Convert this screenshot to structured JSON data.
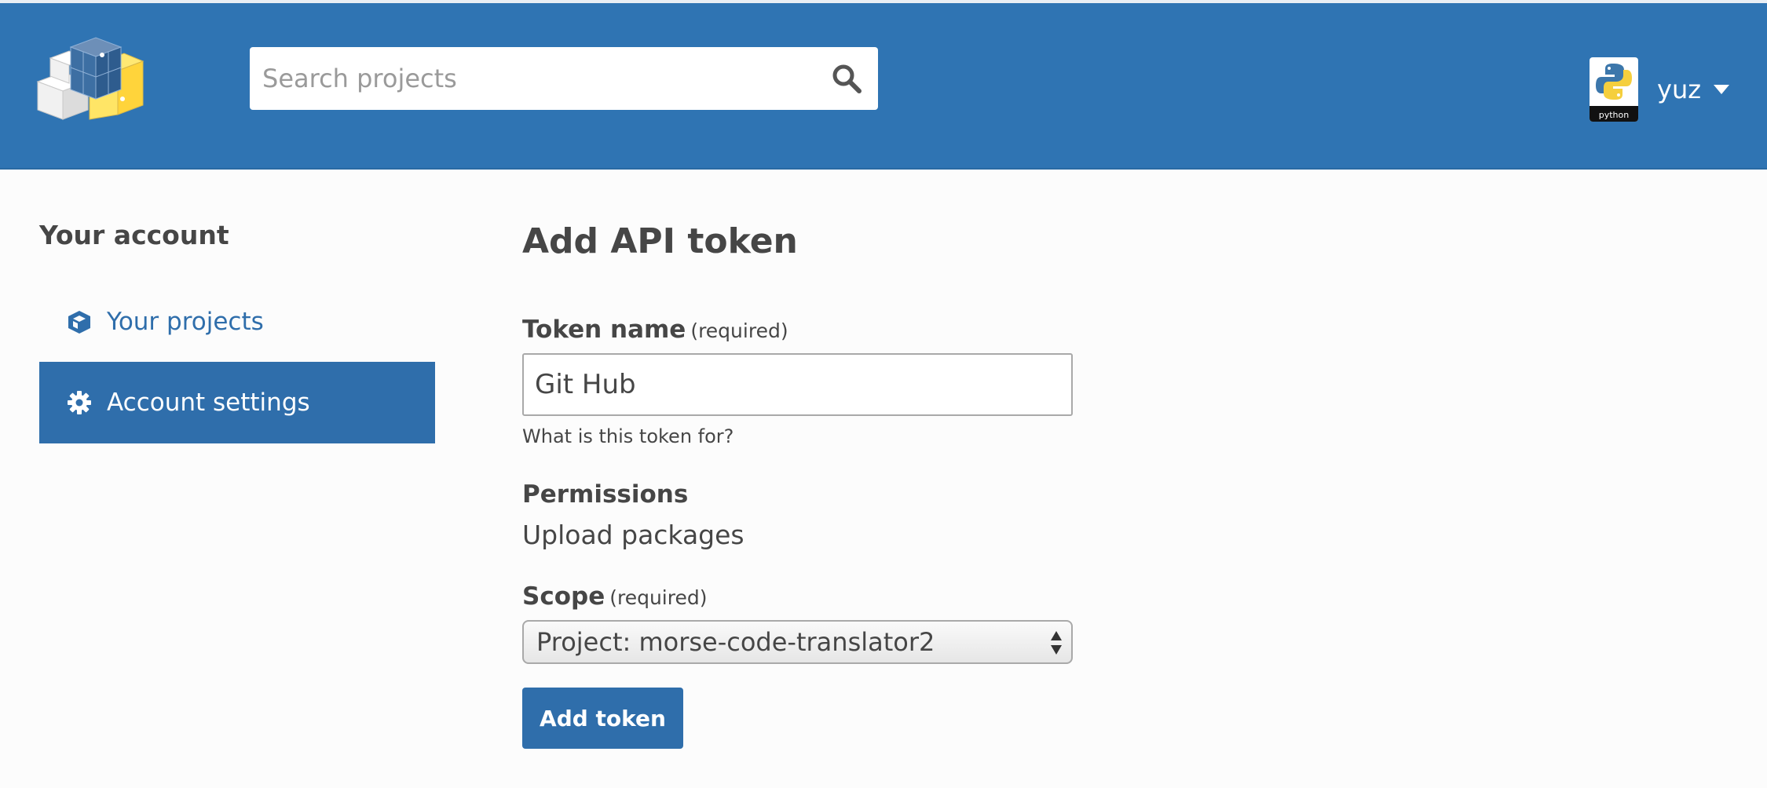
{
  "header": {
    "logo_icon": "pypi-cubes-logo-icon",
    "search": {
      "placeholder": "Search projects",
      "value": "",
      "icon": "search-icon"
    },
    "user": {
      "name": "yuz",
      "avatar_icon": "python-logo-avatar",
      "avatar_caption": "python",
      "menu_icon": "caret-down-icon"
    },
    "colors": {
      "background": "#2f74b3",
      "text": "#ffffff"
    }
  },
  "sidebar": {
    "title": "Your account",
    "items": [
      {
        "label": "Your projects",
        "icon": "cube-icon",
        "active": false
      },
      {
        "label": "Account settings",
        "icon": "gear-icon",
        "active": true
      }
    ],
    "active_color": "#2f6eab"
  },
  "main": {
    "title": "Add API token",
    "token_name": {
      "label": "Token name",
      "required_text": "(required)",
      "value": "Git Hub",
      "help": "What is this token for?"
    },
    "permissions": {
      "label": "Permissions",
      "value": "Upload packages"
    },
    "scope": {
      "label": "Scope",
      "required_text": "(required)",
      "selected": "Project: morse-code-translator2",
      "icon": "select-arrows-icon"
    },
    "submit_label": "Add token",
    "accent_color": "#2f6eab"
  }
}
